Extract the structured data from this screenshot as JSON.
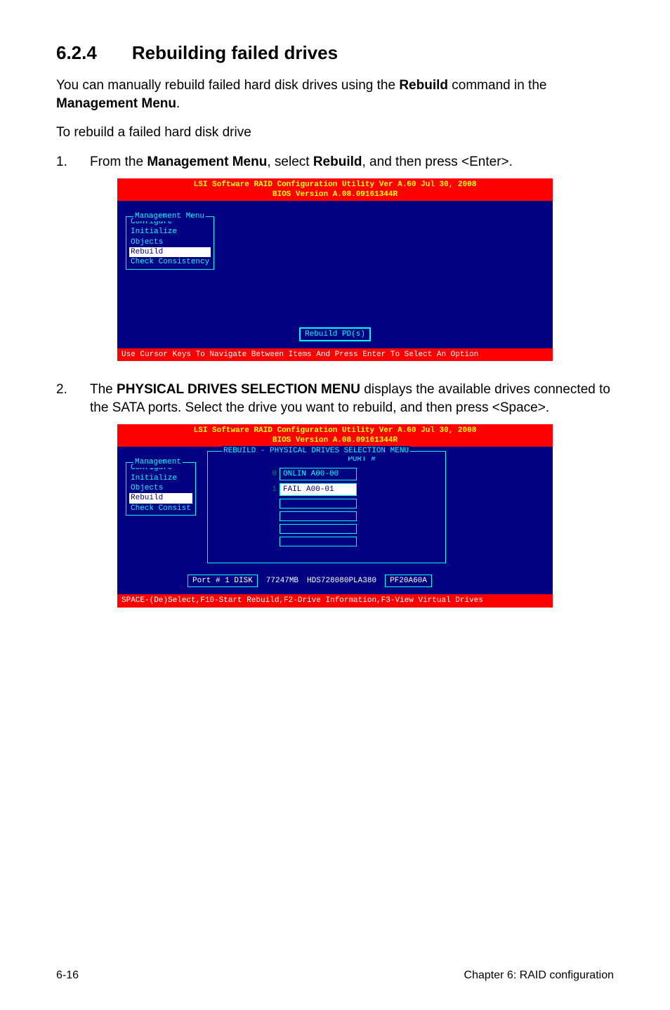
{
  "heading": {
    "number": "6.2.4",
    "title": "Rebuilding failed drives"
  },
  "intro": {
    "prefix": "You can manually rebuild failed hard disk drives using the ",
    "bold1": "Rebuild",
    "mid": " command in the ",
    "bold2": "Management Menu",
    "suffix": "."
  },
  "subintro": "To rebuild a failed hard disk drive",
  "step1": {
    "num": "1.",
    "t1": "From the ",
    "b1": "Management Menu",
    "t2": ", select ",
    "b2": "Rebuild",
    "t3": ", and then press <Enter>."
  },
  "bios1": {
    "title_line1": "LSI Software RAID Configuration Utility Ver A.60 Jul 30, 2008",
    "title_line2": "BIOS Version   A.08.09161344R",
    "menu_title": "Management Menu",
    "items": [
      "Configure",
      "Initialize",
      "Objects",
      "Rebuild",
      "Check Consistency"
    ],
    "highlighted": "Rebuild",
    "status": "Rebuild PD(s)",
    "footer": "Use Cursor Keys To Navigate Between Items And Press Enter To Select An Option"
  },
  "step2": {
    "num": "2.",
    "t1": "The ",
    "b1": "PHYSICAL DRIVES SELECTION MENU",
    "t2": " displays the available drives connected to the SATA ports. Select the drive you want to rebuild, and then press <Space>."
  },
  "bios2": {
    "title_line1": "LSI Software RAID Configuration Utility Ver A.60 Jul 30, 2008",
    "title_line2": "BIOS Version   A.08.09161344R",
    "menu_title": "Management",
    "items": [
      "Configure",
      "Initialize",
      "Objects",
      "Rebuild",
      "Check Consist"
    ],
    "highlighted": "Rebuild",
    "sel_title": "REBUILD - PHYSICAL DRIVES SELECTION MENU",
    "port_header": "PORT #",
    "drives": [
      {
        "idx": "0",
        "label": "ONLIN A00-00",
        "fail": false
      },
      {
        "idx": "1",
        "label": "FAIL  A00-01",
        "fail": true
      }
    ],
    "portinfo": {
      "label": "Port # 1 DISK",
      "size": "77247MB",
      "model": "HDS728080PLA380",
      "serial": "PF20A60A"
    },
    "footer": "SPACE-(De)Select,F10-Start Rebuild,F2-Drive Information,F3-View Virtual Drives"
  },
  "footer": {
    "left": "6-16",
    "right": "Chapter 6: RAID configuration"
  }
}
